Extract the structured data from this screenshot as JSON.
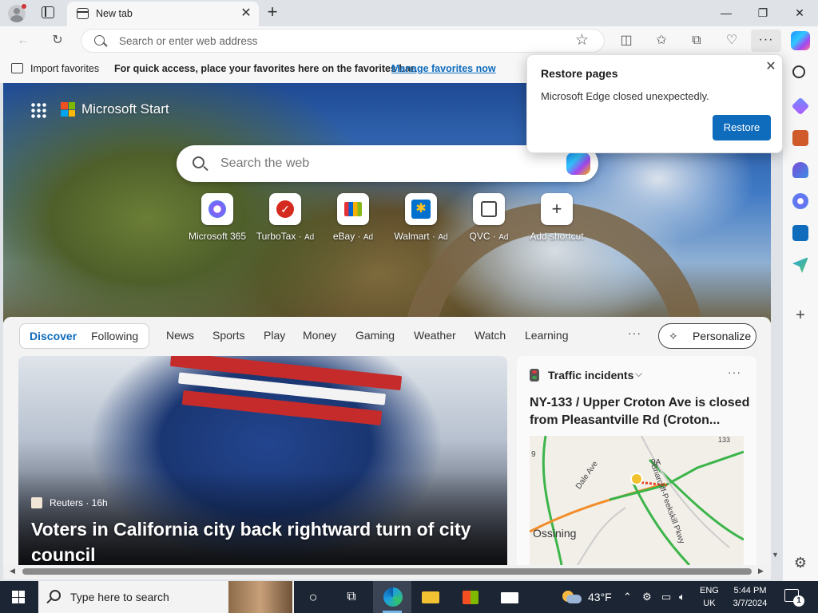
{
  "browser": {
    "tab_title": "New tab",
    "address_placeholder": "Search or enter web address"
  },
  "window_controls": {
    "minimize": "—",
    "restore": "❐",
    "close": "✕"
  },
  "favorites_bar": {
    "import_label": "Import favorites",
    "message": "For quick access, place your favorites here on the favorites bar.",
    "manage_link": "Manage favorites now"
  },
  "restore_popup": {
    "title": "Restore pages",
    "message": "Microsoft Edge closed unexpectedly.",
    "button": "Restore"
  },
  "start_page": {
    "brand": "Microsoft Start",
    "search_placeholder": "Search the web",
    "shortcuts": [
      {
        "name": "Microsoft 365",
        "ad": ""
      },
      {
        "name": "TurboTax",
        "ad": "Ad"
      },
      {
        "name": "eBay",
        "ad": "Ad"
      },
      {
        "name": "Walmart",
        "ad": "Ad"
      },
      {
        "name": "QVC",
        "ad": "Ad"
      },
      {
        "name": "Add shortcut",
        "ad": ""
      }
    ]
  },
  "feed": {
    "segment": [
      "Discover",
      "Following"
    ],
    "nav": [
      "News",
      "Sports",
      "Play",
      "Money",
      "Gaming",
      "Weather",
      "Watch",
      "Learning"
    ],
    "more": "···",
    "personalize": "Personalize",
    "main_story": {
      "source": "Reuters · 16h",
      "headline": "Voters in California city back rightward turn of city council"
    },
    "traffic": {
      "title": "Traffic incidents",
      "headline": "NY-133 / Upper Croton Ave is closed from Pleasantville Rd (Croton...",
      "map_labels": [
        "Ossining",
        "Dale Ave",
        "Briarcliff-Peekskill Pkwy",
        "9",
        "9A",
        "133"
      ]
    }
  },
  "taskbar": {
    "search_placeholder": "Type here to search",
    "weather": "43°F",
    "lang_line1": "ENG",
    "lang_line2": "UK",
    "time": "5:44 PM",
    "date": "3/7/2024",
    "notifications": "1"
  }
}
